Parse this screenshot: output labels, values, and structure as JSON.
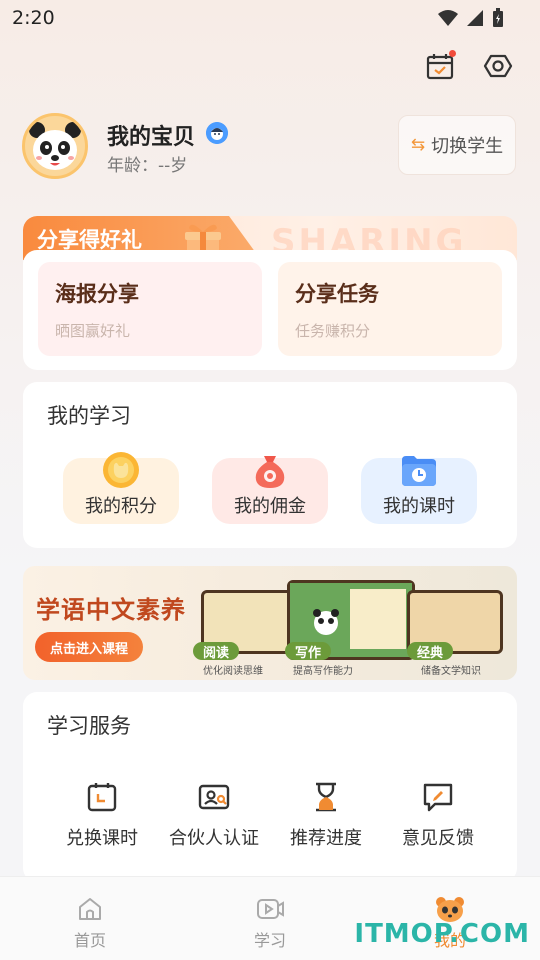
{
  "status_bar": {
    "time": "2:20"
  },
  "profile": {
    "name": "我的宝贝",
    "age": "年龄：--岁",
    "switch_label": "切换学生"
  },
  "share": {
    "title": "分享得好礼",
    "watermark": "SHARING",
    "items": [
      {
        "title": "海报分享",
        "subtitle": "晒图赢好礼"
      },
      {
        "title": "分享任务",
        "subtitle": "任务赚积分"
      }
    ]
  },
  "my_study": {
    "title": "我的学习",
    "items": [
      {
        "label": "我的积分",
        "icon": "coin-icon"
      },
      {
        "label": "我的佣金",
        "icon": "money-bag-icon"
      },
      {
        "label": "我的课时",
        "icon": "clock-folder-icon"
      }
    ]
  },
  "banner": {
    "title": "学语中文素养",
    "button": "点击进入课程",
    "tags": [
      {
        "label": "阅读",
        "caption": "优化阅读思维"
      },
      {
        "label": "写作",
        "caption": "提高写作能力"
      },
      {
        "label": "经典",
        "caption": "储备文学知识"
      }
    ]
  },
  "services": {
    "title": "学习服务",
    "items": [
      {
        "label": "兑换课时",
        "icon": "calendar-clock-icon"
      },
      {
        "label": "合伙人认证",
        "icon": "id-card-icon"
      },
      {
        "label": "推荐进度",
        "icon": "hourglass-icon"
      },
      {
        "label": "意见反馈",
        "icon": "feedback-icon"
      }
    ]
  },
  "bottom_nav": {
    "items": [
      {
        "label": "首页",
        "icon": "home-icon"
      },
      {
        "label": "学习",
        "icon": "video-icon"
      },
      {
        "label": "我的",
        "icon": "panda-icon"
      }
    ]
  },
  "watermark": "ITMOP.COM",
  "colors": {
    "accent": "#f08b32",
    "brand_orange": "#f98a3e",
    "banner_red": "#c0481e"
  }
}
